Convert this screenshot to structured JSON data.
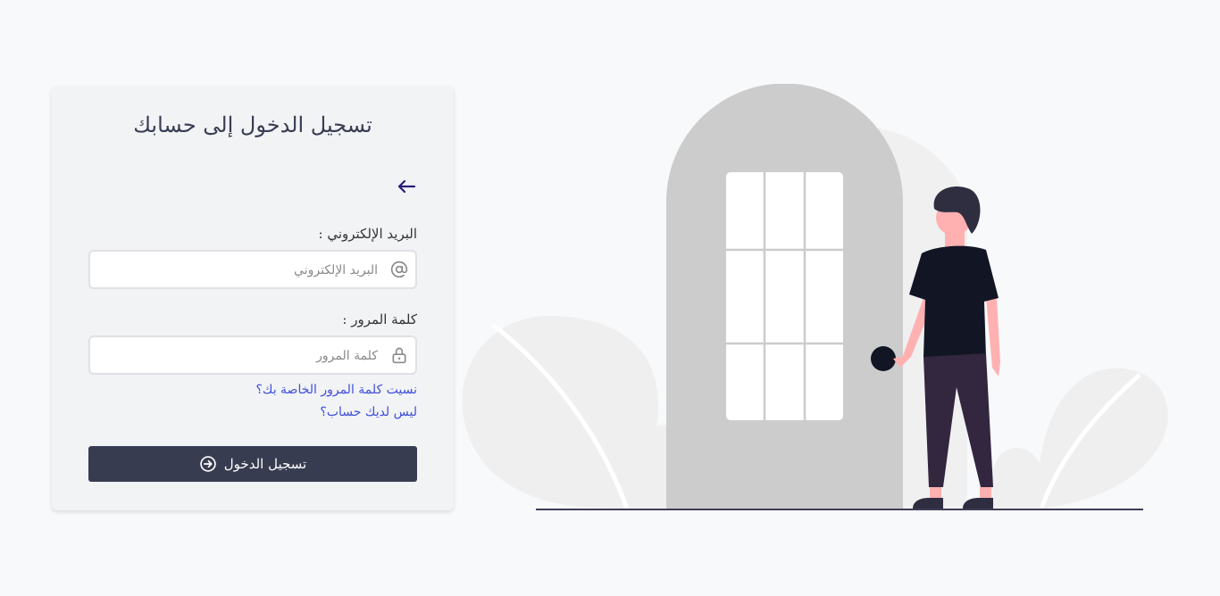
{
  "login": {
    "title": "تسجيل الدخول إلى حسابك",
    "email_label": "البريد الإلكتروني :",
    "email_placeholder": "البريد الإلكتروني",
    "email_value": "",
    "password_label": "كلمة المرور :",
    "password_placeholder": "كلمة المرور",
    "password_value": "",
    "forgot_password_link": "نسيت كلمة المرور الخاصة بك؟",
    "no_account_link": "ليس لديك حساب؟",
    "submit_label": "تسجيل الدخول"
  },
  "icons": {
    "back": "arrow-left-icon",
    "email": "at-sign-icon",
    "password": "lock-icon",
    "submit": "arrow-circle-right-icon"
  },
  "colors": {
    "background": "#f8f9fb",
    "card": "#f2f3f5",
    "button": "#383c51",
    "link": "#3f4fd8",
    "accent_arrow": "#2a1b7a",
    "door": "#cccccc",
    "shirt": "#121524",
    "pants": "#33263f",
    "skin": "#ffb1b1"
  }
}
